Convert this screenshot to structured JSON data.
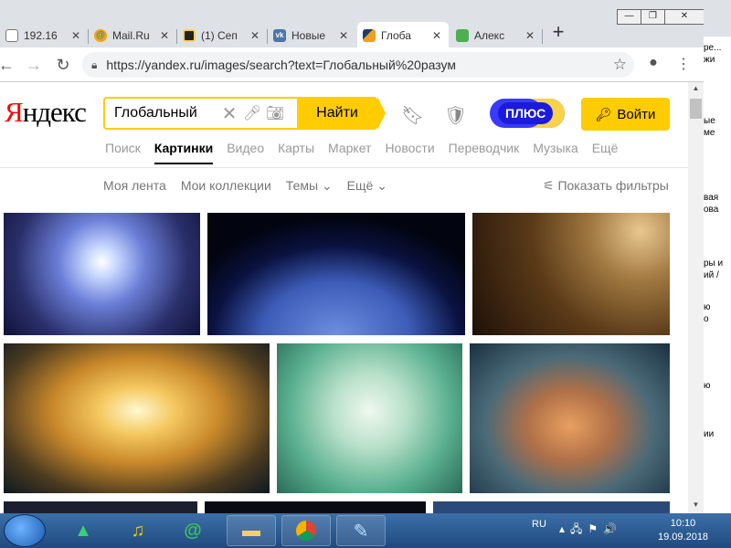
{
  "browser": {
    "tabs": [
      {
        "label": "192.16",
        "favicon_color": "#ffffff"
      },
      {
        "label": "Mail.Ru",
        "favicon_color": "#168de2"
      },
      {
        "label": "(1) Сеп",
        "favicon_color": "#f7d24a"
      },
      {
        "label": "Новые",
        "favicon_color": "#4a76a8"
      },
      {
        "label": "Глоба",
        "favicon_color": "#e8a020"
      },
      {
        "label": "Алекс",
        "favicon_color": "#4caf50"
      }
    ],
    "active_tab_index": 4,
    "url": "https://yandex.ru/images/search?text=Глобальный%20разум"
  },
  "header": {
    "logo": "Яндекс",
    "logo_first": "Я",
    "logo_rest": "ндекс",
    "search_value": "Глобальный",
    "search_button": "Найти",
    "plus_label": "ПЛЮС",
    "login_label": "Войти"
  },
  "services": [
    "Поиск",
    "Картинки",
    "Видео",
    "Карты",
    "Маркет",
    "Новости",
    "Переводчик",
    "Музыка",
    "Ещё"
  ],
  "active_service": "Картинки",
  "subnav": {
    "feed": "Моя лента",
    "collections": "Мои коллекции",
    "themes": "Темы",
    "more": "Ещё",
    "filters": "Показать фильтры"
  },
  "right_strip_text": [
    "ре...",
    "жи",
    "ые",
    "ме",
    "вая",
    "ова",
    "ры и",
    "ий /",
    "ю",
    "о",
    "ю",
    "ии"
  ],
  "taskbar": {
    "lang": "RU",
    "time": "10:10",
    "date": "19.09.2018"
  },
  "colors": {
    "yandex_yellow": "#ffcc00",
    "yandex_red": "#ff0000",
    "plus_blue": "#3a3aff"
  }
}
